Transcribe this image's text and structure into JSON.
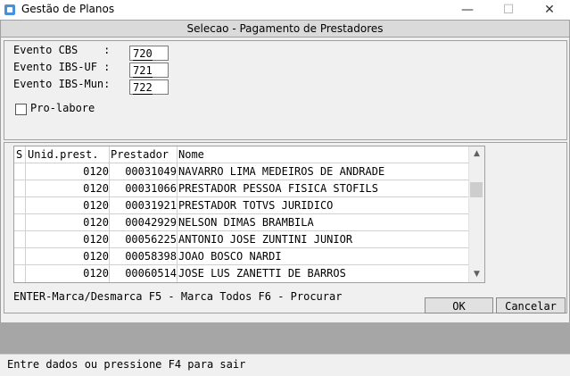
{
  "window": {
    "title": "Gestão de Planos",
    "min_glyph": "—",
    "max_glyph": "☐",
    "close_glyph": "✕"
  },
  "dialog": {
    "title": "Selecao - Pagamento de Prestadores"
  },
  "fields": {
    "cbs_label": "Evento CBS    :",
    "cbs_value": "720",
    "ibs_uf_label": "Evento IBS-UF :",
    "ibs_uf_value": "721",
    "ibs_mun_label": "Evento IBS-Mun:",
    "ibs_mun_value": "722",
    "prolabore_label": "Pro-labore"
  },
  "grid": {
    "headers": {
      "s": "S",
      "unid": "Unid.prest.",
      "prestador": "Prestador",
      "nome": "Nome"
    },
    "rows": [
      {
        "s": "",
        "unid": "0120",
        "prestador": "00031049",
        "nome": "NAVARRO LIMA MEDEIROS DE ANDRADE"
      },
      {
        "s": "",
        "unid": "0120",
        "prestador": "00031066",
        "nome": "PRESTADOR PESSOA FISICA STOFILS"
      },
      {
        "s": "",
        "unid": "0120",
        "prestador": "00031921",
        "nome": "PRESTADOR TOTVS JURIDICO"
      },
      {
        "s": "",
        "unid": "0120",
        "prestador": "00042929",
        "nome": "NELSON DIMAS BRAMBILA"
      },
      {
        "s": "",
        "unid": "0120",
        "prestador": "00056225",
        "nome": "ANTONIO JOSE ZUNTINI JUNIOR"
      },
      {
        "s": "",
        "unid": "0120",
        "prestador": "00058398",
        "nome": "JOAO BOSCO NARDI"
      },
      {
        "s": "",
        "unid": "0120",
        "prestador": "00060514",
        "nome": "JOSE LUS ZANETTI DE BARROS"
      }
    ],
    "scroll_up_glyph": "▲",
    "scroll_down_glyph": "▼"
  },
  "hint": "ENTER-Marca/Desmarca F5 - Marca Todos F6 - Procurar",
  "buttons": {
    "ok": "OK",
    "cancel": "Cancelar"
  },
  "status": "Entre dados ou pressione F4 para sair"
}
